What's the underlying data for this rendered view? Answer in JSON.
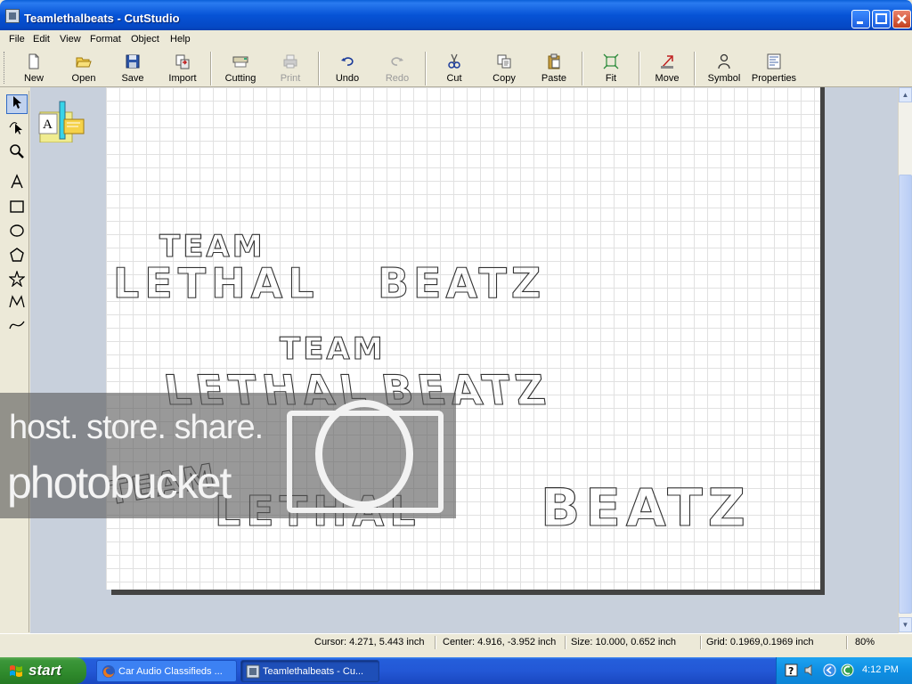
{
  "window": {
    "title": "Teamlethalbeats - CutStudio"
  },
  "menu": {
    "items": [
      "File",
      "Edit",
      "View",
      "Format",
      "Object",
      "Help"
    ]
  },
  "toolbar": {
    "new": "New",
    "open": "Open",
    "save": "Save",
    "import": "Import",
    "cutting": "Cutting",
    "print": "Print",
    "undo": "Undo",
    "redo": "Redo",
    "cut": "Cut",
    "copy": "Copy",
    "paste": "Paste",
    "fit": "Fit",
    "move": "Move",
    "symbol": "Symbol",
    "properties": "Properties"
  },
  "design": {
    "line1": "TEAM",
    "line2a": "LETHAL",
    "line2b": "BEATZ"
  },
  "watermark": {
    "line1": "host. store. share.",
    "line2": "photobucket"
  },
  "status": {
    "cursor": "Cursor: 4.271, 5.443 inch",
    "center": "Center: 4.916, -3.952 inch",
    "size": "Size: 10.000, 0.652 inch",
    "grid": "Grid: 0.1969,0.1969 inch",
    "zoom": "80%"
  },
  "taskbar": {
    "start": "start",
    "tasks": [
      "Car Audio Classifieds ...",
      "Teamlethalbeats - Cu..."
    ],
    "clock": "4:12 PM"
  },
  "colors": {
    "titlebar": "#0653d6",
    "taskbar": "#245edb",
    "start": "#3c973a",
    "tray": "#0f8fe3"
  }
}
